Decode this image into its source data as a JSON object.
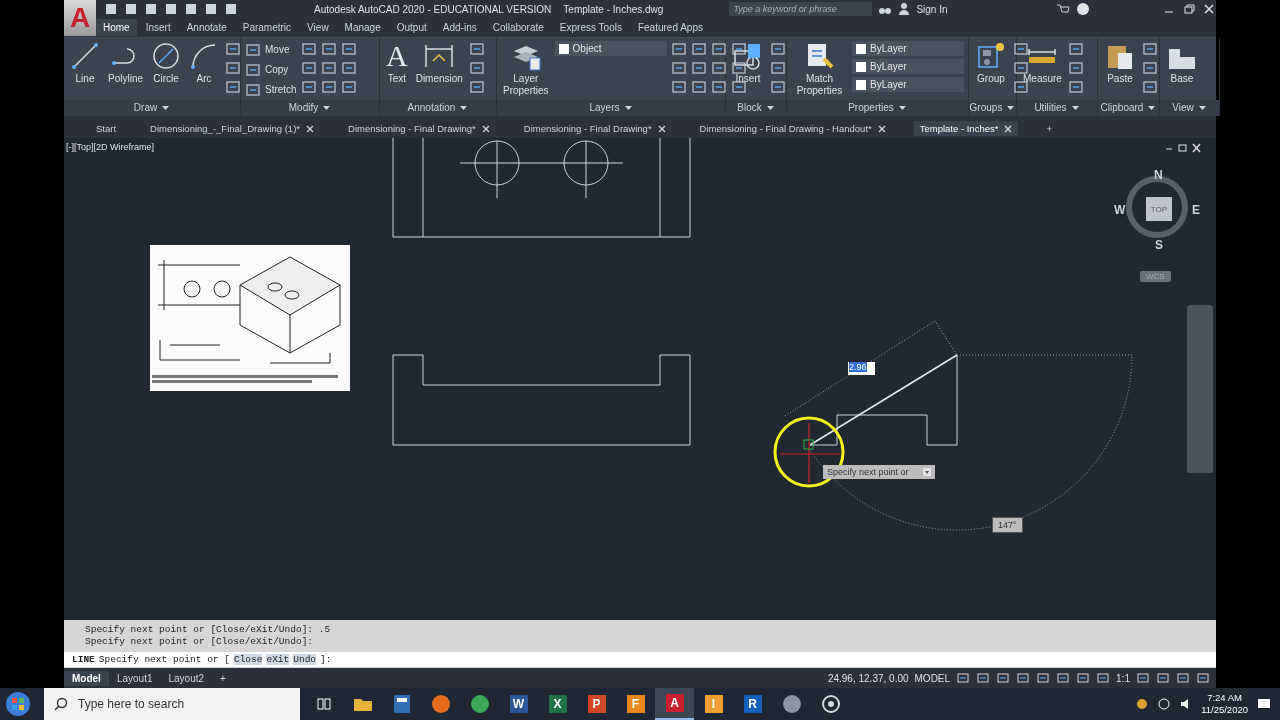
{
  "title_bar": {
    "app_button": "A",
    "title": "Autodesk AutoCAD 2020 - EDUCATIONAL VERSION",
    "file": "Template - Inches.dwg",
    "search": {
      "placeholder": "Type a keyword or phrase"
    },
    "sign_in": "Sign In"
  },
  "ribbon_tabs": [
    {
      "label": "Home",
      "selected": true
    },
    {
      "label": "Insert",
      "selected": false
    },
    {
      "label": "Annotate",
      "selected": false
    },
    {
      "label": "Parametric",
      "selected": false
    },
    {
      "label": "View",
      "selected": false
    },
    {
      "label": "Manage",
      "selected": false
    },
    {
      "label": "Output",
      "selected": false
    },
    {
      "label": "Add-ins",
      "selected": false
    },
    {
      "label": "Collaborate",
      "selected": false
    },
    {
      "label": "Express Tools",
      "selected": false
    },
    {
      "label": "Featured Apps",
      "selected": false
    }
  ],
  "ribbon_panels": [
    {
      "title": "Draw",
      "tools": [
        {
          "kind": "line",
          "label": "Line"
        },
        {
          "kind": "polyline",
          "label": "Polyline"
        },
        {
          "kind": "circle",
          "label": "Circle"
        },
        {
          "kind": "arc",
          "label": "Arc"
        }
      ]
    },
    {
      "title": "Modify",
      "tools": [
        {
          "kind": "small",
          "label": "Move"
        },
        {
          "kind": "small",
          "label": "Copy"
        },
        {
          "kind": "small",
          "label": "Stretch"
        }
      ]
    },
    {
      "title": "Annotation",
      "tools": [
        {
          "kind": "text",
          "glyph": "A",
          "label": "Text"
        },
        {
          "kind": "dimension",
          "label": "Dimension"
        }
      ]
    },
    {
      "title": "Layers",
      "tools": [
        {
          "kind": "layers",
          "label": "Layer Properties"
        },
        {
          "kind": "dropdown",
          "value": "Object"
        }
      ]
    },
    {
      "title": "Block",
      "tools": [
        {
          "kind": "insert",
          "label": "Insert"
        }
      ]
    },
    {
      "title": "Properties",
      "tools": [
        {
          "kind": "match",
          "label": "Match Properties"
        },
        {
          "kind": "dropdown",
          "value": "ByLayer"
        },
        {
          "kind": "dropdown",
          "value": "ByLayer"
        },
        {
          "kind": "dropdown",
          "value": "ByLayer"
        }
      ]
    },
    {
      "title": "Groups",
      "tools": [
        {
          "kind": "group",
          "label": "Group"
        }
      ]
    },
    {
      "title": "Utilities",
      "tools": [
        {
          "kind": "measure",
          "label": "Measure"
        }
      ]
    },
    {
      "title": "Clipboard",
      "tools": [
        {
          "kind": "paste",
          "label": "Paste"
        }
      ]
    },
    {
      "title": "View",
      "tools": [
        {
          "kind": "base",
          "label": "Base"
        }
      ]
    }
  ],
  "doc_tabs": [
    {
      "label": "Start",
      "selected": false
    },
    {
      "label": "Dimensioning_-_Final_Drawing (1)*",
      "selected": false
    },
    {
      "label": "Dimensioning - Final Drawing*",
      "selected": false
    },
    {
      "label": "Dimensioning - Final Drawing*",
      "selected": false
    },
    {
      "label": "Dimensioning - Final Drawing - Handout*",
      "selected": false
    },
    {
      "label": "Template - Inches*",
      "selected": true
    }
  ],
  "new_tab": "+",
  "viewport": {
    "label": "[-][Top][2D Wireframe]",
    "tooltip": "Specify next point or",
    "length_input": "2.96",
    "angle": "147°"
  },
  "viewcube": {
    "north": "N",
    "south": "S",
    "east": "E",
    "west": "W",
    "face": "TOP",
    "ucs": "WCS"
  },
  "command": {
    "history": [
      "Specify next point or [Close/eXit/Undo]: .5",
      "Specify next point or [Close/eXit/Undo]:"
    ],
    "name": "LINE",
    "prompt": "Specify next point or [",
    "options": [
      "Close",
      "eXit",
      "Undo"
    ],
    "end": "]:"
  },
  "layout_tabs": [
    {
      "label": "Model",
      "selected": true
    },
    {
      "label": "Layout1",
      "selected": false
    },
    {
      "label": "Layout2",
      "selected": false
    }
  ],
  "new_layout": "+",
  "status_bar": {
    "coordinates": "24.96, 12.37, 0.00",
    "space": "MODEL",
    "scale": "1:1"
  },
  "taskbar": {
    "search": {
      "placeholder": "Type here to search"
    },
    "time": "7:24 AM",
    "date": "11/25/2020",
    "apps": [
      {
        "kind": "taskview",
        "selected": false
      },
      {
        "kind": "folder",
        "color": "#e8b33c",
        "selected": false
      },
      {
        "kind": "tile",
        "color": "#2f6fb5",
        "selected": false
      },
      {
        "kind": "round",
        "color": "#e66b1f",
        "selected": false
      },
      {
        "kind": "round",
        "color": "#3aa757",
        "selected": false
      },
      {
        "kind": "glyph",
        "glyph": "W",
        "color": "#2b579a",
        "selected": false
      },
      {
        "kind": "glyph",
        "glyph": "X",
        "color": "#217346",
        "selected": false
      },
      {
        "kind": "glyph",
        "glyph": "P",
        "color": "#d24726",
        "selected": false
      },
      {
        "kind": "glyph",
        "glyph": "F",
        "color": "#e8891c",
        "selected": false
      },
      {
        "kind": "glyph",
        "glyph": "A",
        "color": "#c8202f",
        "selected": true
      },
      {
        "kind": "glyph",
        "glyph": "I",
        "color": "#f0a030",
        "selected": false
      },
      {
        "kind": "glyph",
        "glyph": "R",
        "color": "#1560bd",
        "selected": false
      },
      {
        "kind": "round",
        "color": "#8a96a6",
        "selected": false
      },
      {
        "kind": "ring",
        "color": "#cfd6de",
        "selected": false
      }
    ]
  }
}
